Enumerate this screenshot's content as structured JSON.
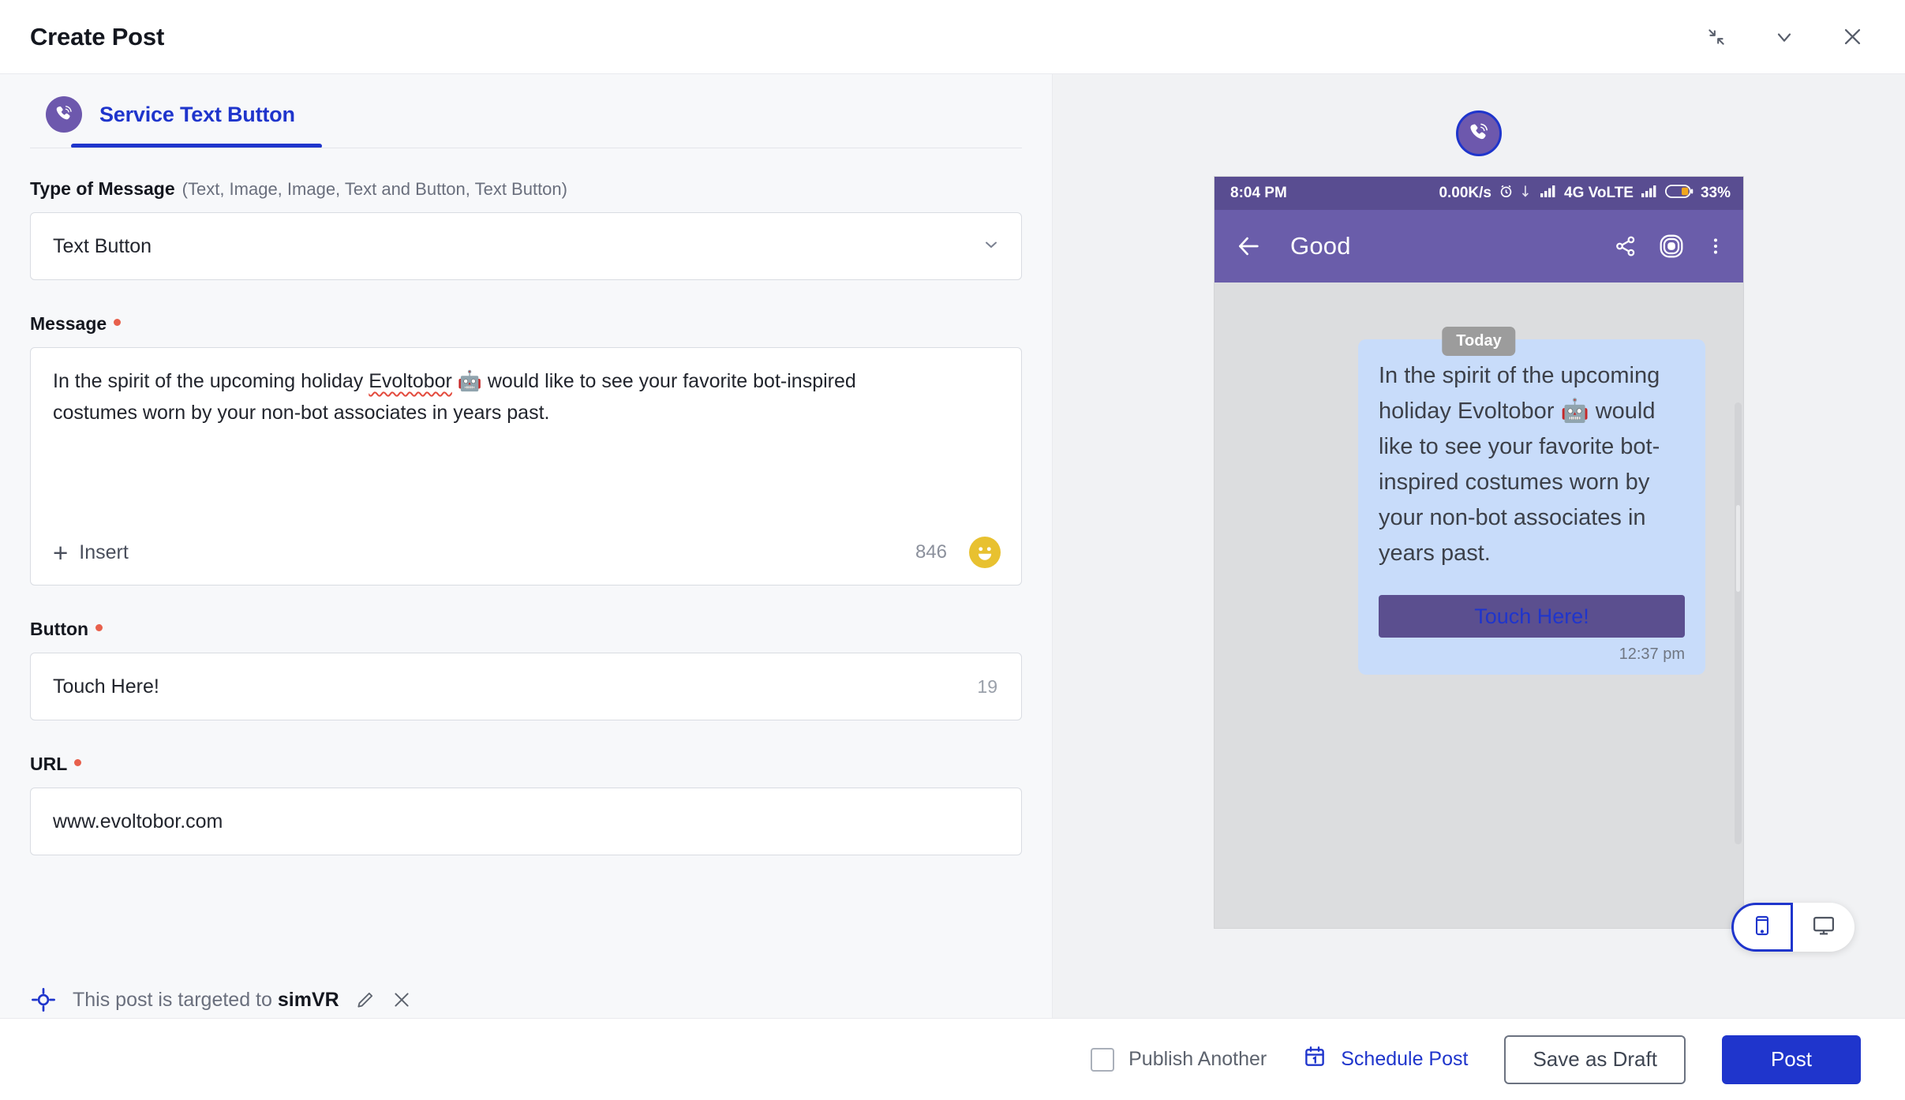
{
  "window": {
    "title": "Create Post",
    "controls": [
      {
        "name": "collapse-icon",
        "label": "Collapse"
      },
      {
        "name": "chevron-down-icon",
        "label": "Minimize"
      },
      {
        "name": "close-icon",
        "label": "Close"
      }
    ]
  },
  "tab": {
    "label": "Service Text Button",
    "channel_icon": "viber-icon"
  },
  "form": {
    "type_of_message": {
      "label": "Type of Message",
      "hint": "(Text, Image, Image, Text and Button, Text Button)",
      "value": "Text Button",
      "options": [
        "Text",
        "Image",
        "Image",
        "Text and Button",
        "Text Button"
      ]
    },
    "message": {
      "label": "Message",
      "required": true,
      "value_part1": "In the spirit of the upcoming holiday ",
      "value_spell": "Evoltobor",
      "value_part2": " 🤖 would like to see your favorite bot-inspired costumes worn by your non-bot associates in years past.",
      "insert_label": "Insert",
      "counter": "846",
      "emoji_icon": "smiley-icon"
    },
    "button": {
      "label": "Button",
      "required": true,
      "value": "Touch Here!",
      "counter": "19"
    },
    "url": {
      "label": "URL",
      "required": true,
      "value": "www.evoltobor.com"
    },
    "targeting": {
      "prefix": "This post is targeted to ",
      "target": "simVR",
      "edit_icon": "pencil-icon",
      "remove_icon": "close-icon"
    }
  },
  "preview": {
    "logo_icon": "viber-icon",
    "statusbar": {
      "time": "8:04 PM",
      "net_speed": "0.00K/s",
      "network": "4G VoLTE",
      "battery": "33%"
    },
    "appbar": {
      "back_icon": "back-arrow-icon",
      "title": "Good",
      "share_icon": "share-icon",
      "viber-target_icon": "viber-ring-icon",
      "menu_icon": "kebab-menu-icon"
    },
    "chat": {
      "date_divider": "Today",
      "bubble_text": "In the spirit of the upcoming holiday Evoltobor 🤖 would like to see your favorite bot-inspired costumes worn by your non-bot associates in years past.",
      "bubble_button": "Touch Here!",
      "timestamp": "12:37 pm"
    },
    "device_toggle": {
      "mobile_icon": "mobile-icon",
      "desktop_icon": "desktop-icon",
      "selected": "mobile"
    }
  },
  "footer": {
    "publish_another": "Publish Another",
    "schedule_post": "Schedule Post",
    "schedule_icon": "calendar-icon",
    "save_as_draft": "Save as Draft",
    "post": "Post"
  },
  "colors": {
    "accent_blue": "#1f35cc",
    "viber_purple": "#6d58ad",
    "required_red": "#e8604c",
    "bubble_blue": "#c8dcfa"
  }
}
